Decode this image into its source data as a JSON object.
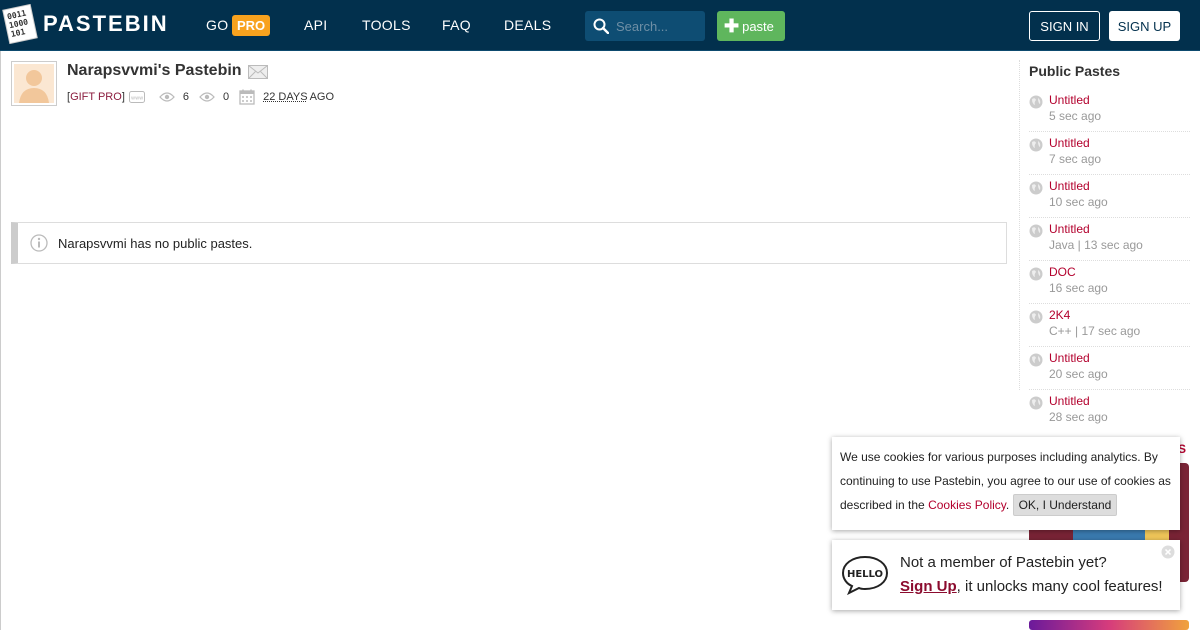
{
  "header": {
    "logo_mark_digits": [
      "0011",
      "1000",
      "101"
    ],
    "logo_text": "PASTEBIN",
    "nav": {
      "go": "GO",
      "pro": "PRO",
      "api": "API",
      "tools": "TOOLS",
      "faq": "FAQ",
      "deals": "DEALS"
    },
    "search_placeholder": "Search...",
    "paste_label": "paste",
    "sign_in": "SIGN IN",
    "sign_up": "SIGN UP"
  },
  "profile": {
    "title": "Narapsvvmi's Pastebin",
    "gift_pro": "GIFT PRO",
    "views": "6",
    "views_all": "0",
    "joined_days": "22 DAYS",
    "joined_suffix": "AGO"
  },
  "notice": {
    "text": "Narapsvvmi has no public pastes."
  },
  "sidebar": {
    "title": "Public Pastes",
    "items": [
      {
        "name": "Untitled",
        "meta": "5 sec ago"
      },
      {
        "name": "Untitled",
        "meta": "7 sec ago"
      },
      {
        "name": "Untitled",
        "meta": "10 sec ago"
      },
      {
        "name": "Untitled",
        "meta": "Java | 13 sec ago"
      },
      {
        "name": "DOC",
        "meta": "16 sec ago"
      },
      {
        "name": "2K4",
        "meta": "C++ | 17 sec ago"
      },
      {
        "name": "Untitled",
        "meta": "20 sec ago"
      },
      {
        "name": "Untitled",
        "meta": "28 sec ago"
      }
    ],
    "ad_fragment": "S"
  },
  "cookie": {
    "text": "We use cookies for various purposes including analytics. By continuing to use Pastebin, you agree to our use of cookies as described in the",
    "link": "Cookies Policy",
    "period": ".",
    "button": "OK, I Understand"
  },
  "hello": {
    "icon_text": "HELLO",
    "line1": "Not a member of Pastebin yet?",
    "signup": "Sign Up",
    "line2_rest": ", it unlocks many cool features!"
  },
  "colors": {
    "header_bg": "#02304d",
    "pro_orange": "#f8a21e",
    "paste_green": "#5fb65d",
    "link_red": "#b3002d"
  }
}
